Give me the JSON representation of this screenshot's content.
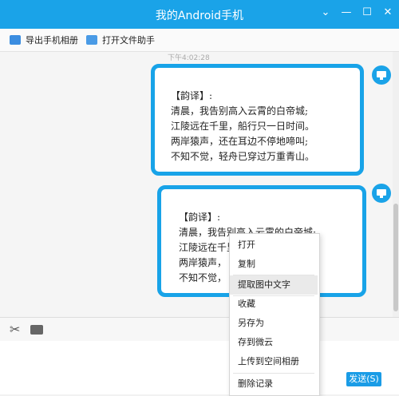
{
  "window": {
    "title": "我的Android手机",
    "controls": [
      "chevron-down-icon",
      "minimize-icon",
      "maximize-icon",
      "close-icon"
    ]
  },
  "toolbar": {
    "export_label": "导出手机相册",
    "open_folder_label": "打开文件助手"
  },
  "chat": {
    "timestamp": "下午4:02:28",
    "message1": {
      "lines": [
        "【韵译】:",
        "清晨，我告别高入云霄的白帝城;",
        "江陵远在千里，船行只一日时间。",
        "两岸猿声，还在耳边不停地啼叫;",
        "不知不觉，轻舟已穿过万重青山。"
      ]
    },
    "message2": {
      "lines": [
        "【韵译】:",
        "清晨，我告别高入云霄的白帝城;",
        "江陵远在千里，",
        "两岸猿声，",
        "不知不觉，"
      ]
    }
  },
  "input": {
    "send_label": "发送(S)"
  },
  "context_menu": {
    "items": [
      {
        "label": "打开",
        "highlighted": false
      },
      {
        "label": "复制",
        "highlighted": false
      },
      {
        "label": "提取图中文字",
        "highlighted": true
      },
      {
        "label": "收藏",
        "highlighted": false
      },
      {
        "label": "另存为",
        "highlighted": false
      },
      {
        "label": "存到微云",
        "highlighted": false
      },
      {
        "label": "上传到空间相册",
        "highlighted": false
      },
      {
        "label": "删除记录",
        "highlighted": false
      }
    ]
  },
  "colors": {
    "accent": "#1aa3e8",
    "bubble_border": "#18a3e8"
  }
}
